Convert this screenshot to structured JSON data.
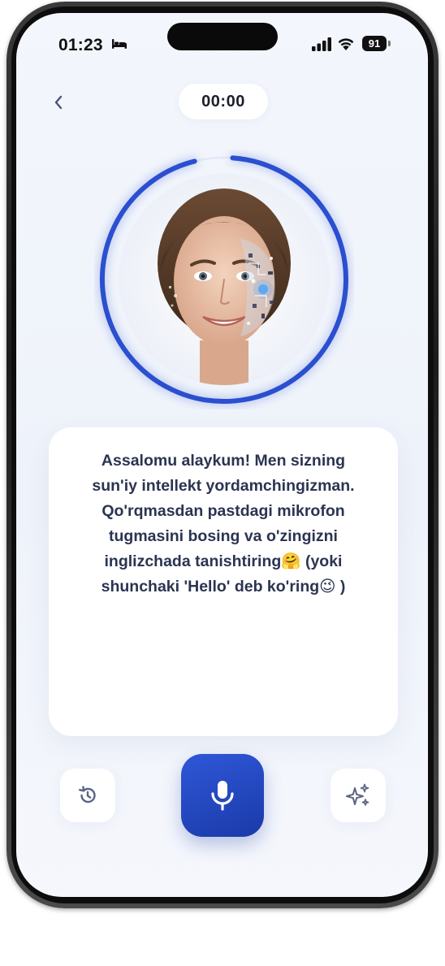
{
  "status_bar": {
    "time": "01:23",
    "battery": "91",
    "icons": [
      "bed-icon",
      "cellular-signal-icon",
      "wifi-icon",
      "battery-icon"
    ]
  },
  "header": {
    "back_icon": "chevron-left-icon",
    "timer": "00:00"
  },
  "avatar": {
    "ring_color": "#2a4fd0",
    "ring_progress": 0.95
  },
  "message": {
    "text": "Assalomu alaykum! Men sizning\nsun'iy intellekt yordamchingizman.\nQo'rqmasdan pastdagi mikrofon\ntugmasini bosing va o'zingizni\ninglizchada tanishtiring🤗 (yoki\nshunchaki 'Hello' deb ko'ring😉 )"
  },
  "controls": {
    "history_icon": "history-icon",
    "mic_icon": "microphone-icon",
    "sparkle_icon": "sparkles-icon"
  },
  "colors": {
    "accent": "#2a4fd0",
    "text_primary": "#2b3451",
    "screen_bg": "#f1f4fb"
  }
}
